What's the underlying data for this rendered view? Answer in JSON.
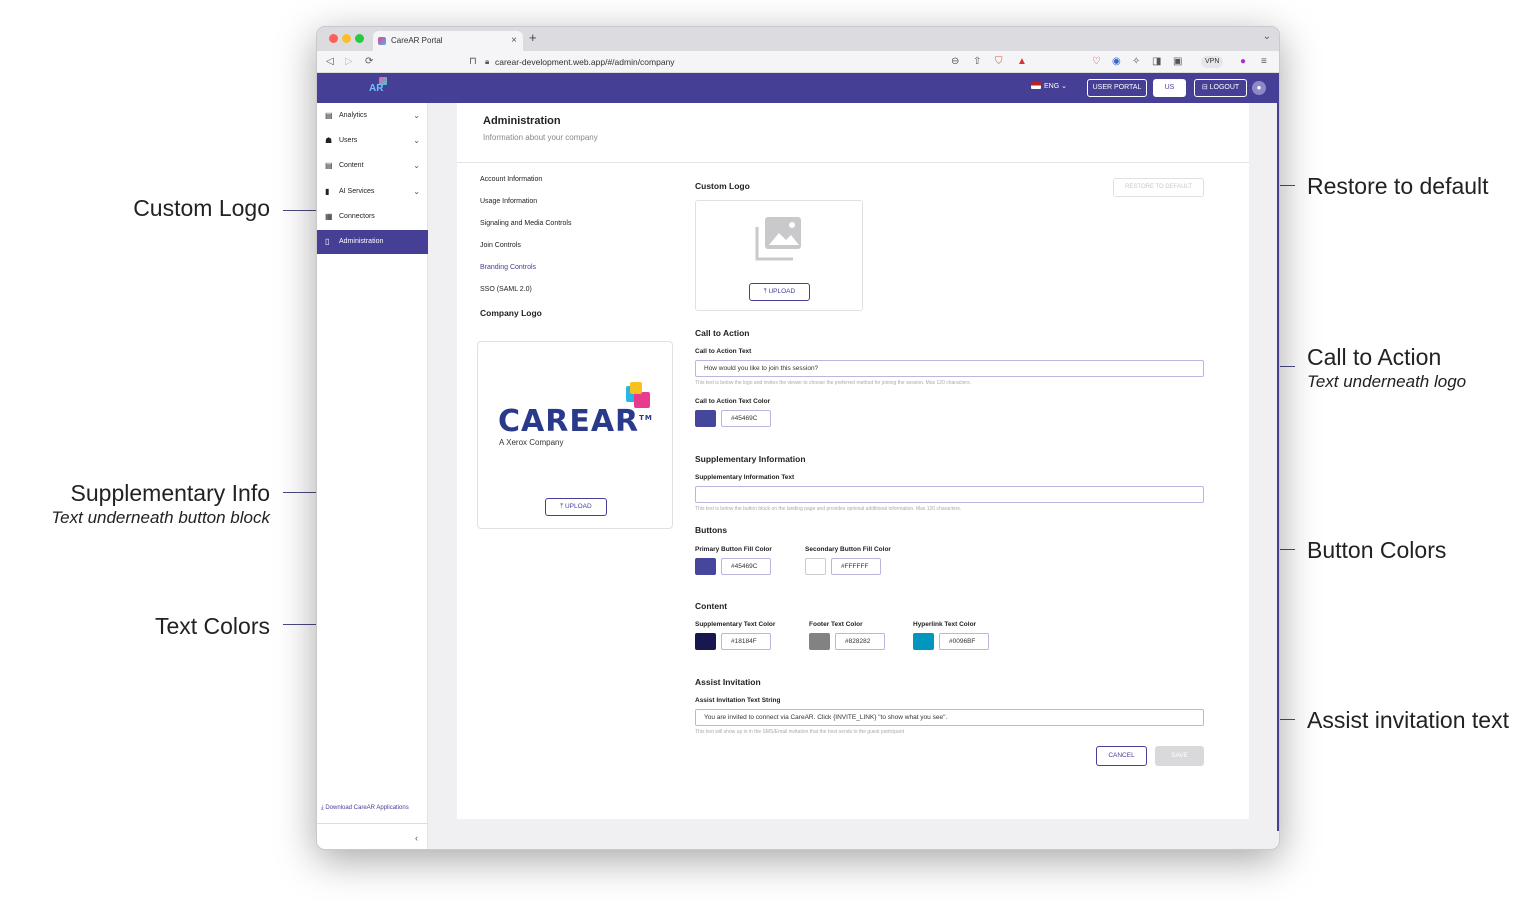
{
  "browser": {
    "tab_title": "CareAR Portal",
    "url": "carear-development.web.app/#/admin/company",
    "vpn_label": "VPN"
  },
  "header": {
    "lang": "ENG",
    "user_portal": "USER PORTAL",
    "region": "US",
    "logout": "LOGOUT",
    "brand_accent": "#453f96"
  },
  "sidebar": {
    "items": [
      {
        "label": "Analytics",
        "icon": "chart-icon"
      },
      {
        "label": "Users",
        "icon": "users-icon"
      },
      {
        "label": "Content",
        "icon": "content-icon"
      },
      {
        "label": "AI Services",
        "icon": "ai-icon"
      },
      {
        "label": "Connectors",
        "icon": "grid-icon"
      },
      {
        "label": "Administration",
        "icon": "admin-icon"
      }
    ],
    "download": "Download CareAR Applications"
  },
  "page": {
    "title": "Administration",
    "subtitle": "Information about your company"
  },
  "subnav": [
    "Account Information",
    "Usage Information",
    "Signaling and Media Controls",
    "Join Controls",
    "Branding Controls",
    "SSO (SAML 2.0)"
  ],
  "company_logo": {
    "label": "Company Logo",
    "brand": "CAREAR",
    "tm": "TM",
    "tagline": "A Xerox Company",
    "upload": "UPLOAD"
  },
  "custom_logo": {
    "label": "Custom Logo",
    "upload": "UPLOAD",
    "restore": "RESTORE TO DEFAULT"
  },
  "cta": {
    "section": "Call to Action",
    "text_label": "Call to Action Text",
    "text_value": "How would you like to join this session?",
    "help": "This text is below the logo and invites the viewer to choose the preferred method for joining the session. Max 120 characters.",
    "color_label": "Call to Action Text Color",
    "color_value": "#45469C"
  },
  "supp": {
    "section": "Supplementary Information",
    "text_label": "Supplementary Information Text",
    "text_value": "",
    "help": "This text is below the button block on the landing page and provides optional additional information. Max 120 characters."
  },
  "buttons": {
    "section": "Buttons",
    "primary_label": "Primary Button Fill Color",
    "primary_value": "#45469C",
    "secondary_label": "Secondary Button Fill Color",
    "secondary_value": "#FFFFFF"
  },
  "content": {
    "section": "Content",
    "supp_label": "Supplementary Text Color",
    "supp_value": "#18184F",
    "footer_label": "Footer Text Color",
    "footer_value": "#828282",
    "link_label": "Hyperlink Text Color",
    "link_value": "#0096BF"
  },
  "assist": {
    "section": "Assist Invitation",
    "text_label": "Assist Invitation Text String",
    "text_value": "You are invited to connect via CareAR. Click {INVITE_LINK} \"to show what you see\".",
    "help": "This text will show up in in the SMS/Email invitation that the host sends to the guest participant"
  },
  "actions": {
    "cancel": "CANCEL",
    "save": "SAVE"
  },
  "callouts": {
    "custom_logo": "Custom Logo",
    "supp_title": "Supplementary Info",
    "supp_sub": "Text underneath button block",
    "text_colors": "Text Colors",
    "restore": "Restore to default",
    "cta_title": "Call to Action",
    "cta_sub": "Text underneath logo",
    "button_colors": "Button Colors",
    "assist": "Assist invitation text"
  }
}
